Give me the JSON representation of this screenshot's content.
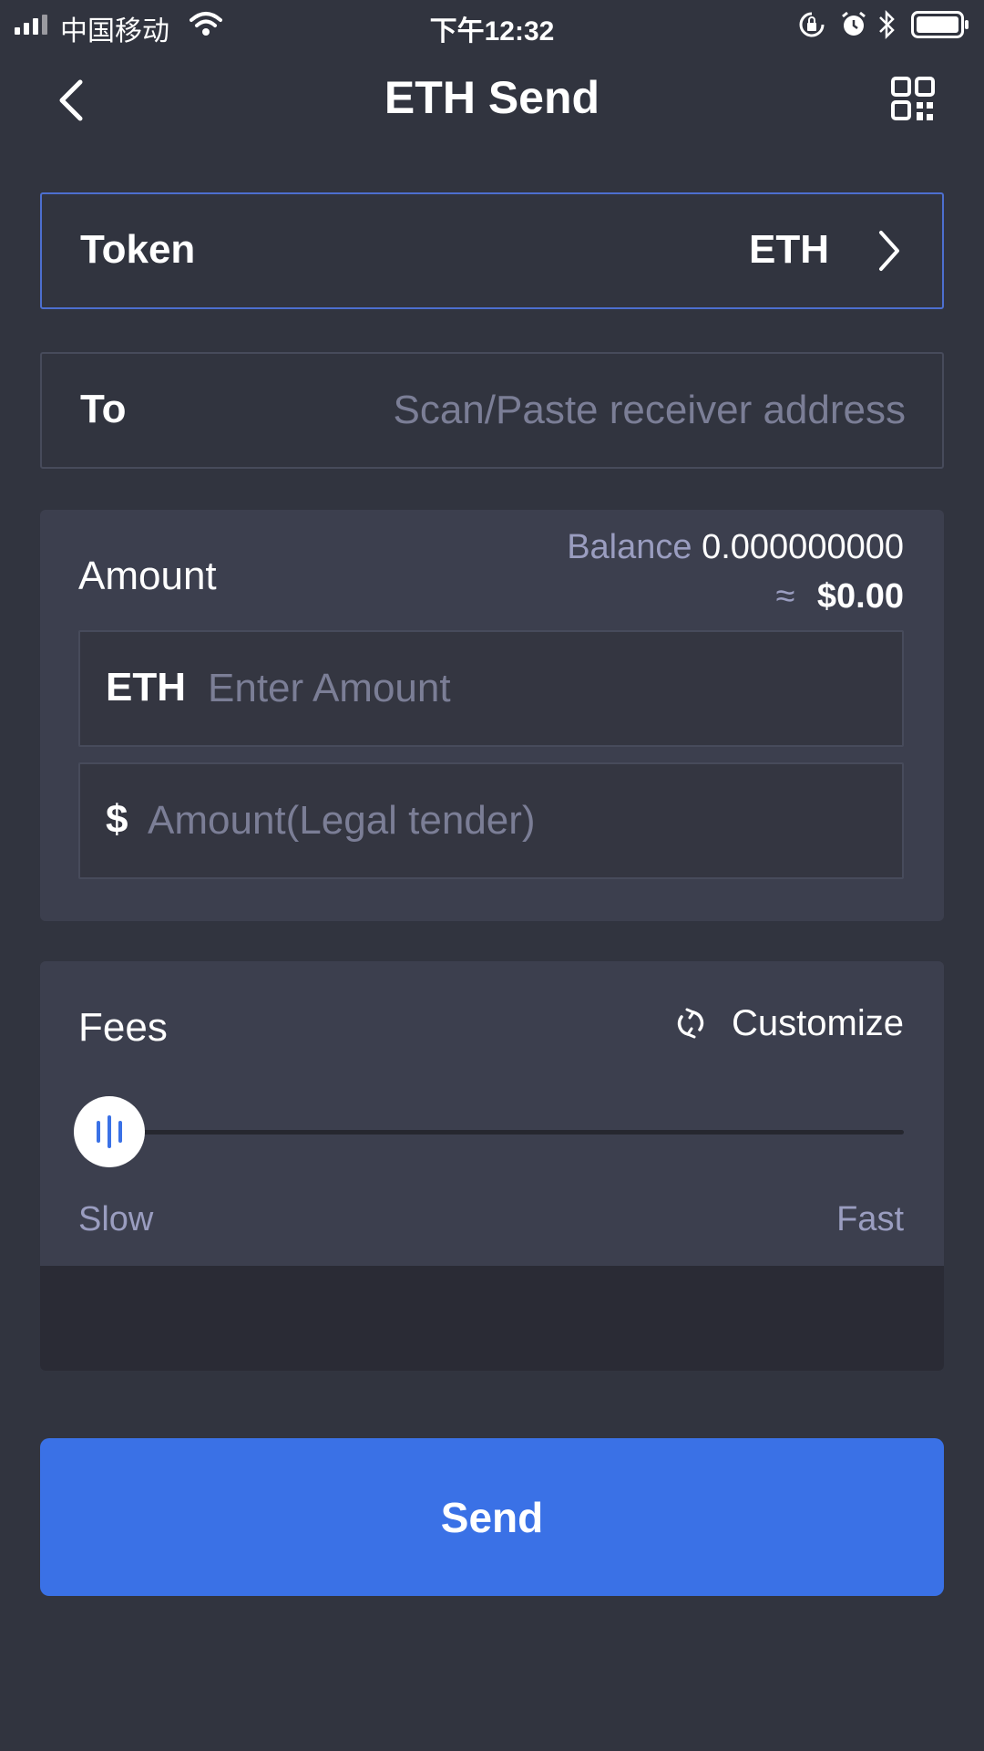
{
  "status_bar": {
    "carrier": "中国移动",
    "time": "下午12:32",
    "icons": [
      "signal-icon",
      "wifi-icon",
      "rotation-lock-icon",
      "alarm-icon",
      "bluetooth-icon",
      "battery-icon"
    ]
  },
  "nav": {
    "title": "ETH Send",
    "back_icon": "chevron-left-icon",
    "scan_icon": "qr-code-icon"
  },
  "token": {
    "label": "Token",
    "value": "ETH"
  },
  "to": {
    "label": "To",
    "placeholder": "Scan/Paste receiver address",
    "value": ""
  },
  "amount": {
    "title": "Amount",
    "balance_label": "Balance",
    "balance_value": "0.000000000",
    "approx_symbol": "≈",
    "fiat_value": "$0.00",
    "crypto_prefix": "ETH",
    "crypto_placeholder": "Enter Amount",
    "fiat_prefix": "$",
    "fiat_placeholder": "Amount(Legal tender)"
  },
  "fees": {
    "title": "Fees",
    "customize_label": "Customize",
    "slow_label": "Slow",
    "fast_label": "Fast",
    "slider_level": 0
  },
  "send_label": "Send",
  "colors": {
    "background": "#31343f",
    "panel": "#3c3f4e",
    "accent": "#3a71e6",
    "active_border": "#4d6fcf",
    "muted_text": "#9a9dc0",
    "placeholder": "#7b7e96"
  }
}
